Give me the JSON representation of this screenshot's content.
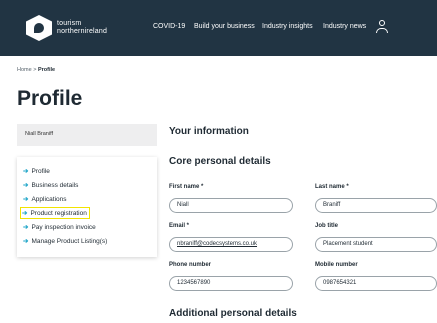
{
  "brand": {
    "line1": "tourism",
    "line2": "northernireland"
  },
  "nav": [
    "COVID-19",
    "Build your business",
    "Industry insights",
    "Industry news"
  ],
  "breadcrumb": {
    "home": "Home",
    "separator": ">",
    "current": "Profile"
  },
  "page_title": "Profile",
  "user_name": "Niall Braniff",
  "sidebar": {
    "items": [
      {
        "label": "Profile"
      },
      {
        "label": "Business details"
      },
      {
        "label": "Applications"
      },
      {
        "label": "Product registration",
        "highlighted": true
      },
      {
        "label": "Pay inspection invoice"
      },
      {
        "label": "Manage Product Listing(s)"
      }
    ],
    "arrow": "➔"
  },
  "main": {
    "section_title": "Your information",
    "core_title": "Core personal details",
    "additional_title": "Additional personal details",
    "fields": {
      "first_name": {
        "label": "First name *",
        "value": "Niall"
      },
      "last_name": {
        "label": "Last name *",
        "value": "Braniff"
      },
      "email": {
        "label": "Email *",
        "value": "nbraniff@codecsystems.co.uk"
      },
      "job_title": {
        "label": "Job title",
        "value": "Placement student"
      },
      "phone": {
        "label": "Phone number",
        "value": "1234567890"
      },
      "mobile": {
        "label": "Mobile number",
        "value": "0987654321"
      }
    }
  },
  "colors": {
    "header_bg": "#213443",
    "accent": "#1aa3c7",
    "highlight": "#f2e400"
  }
}
